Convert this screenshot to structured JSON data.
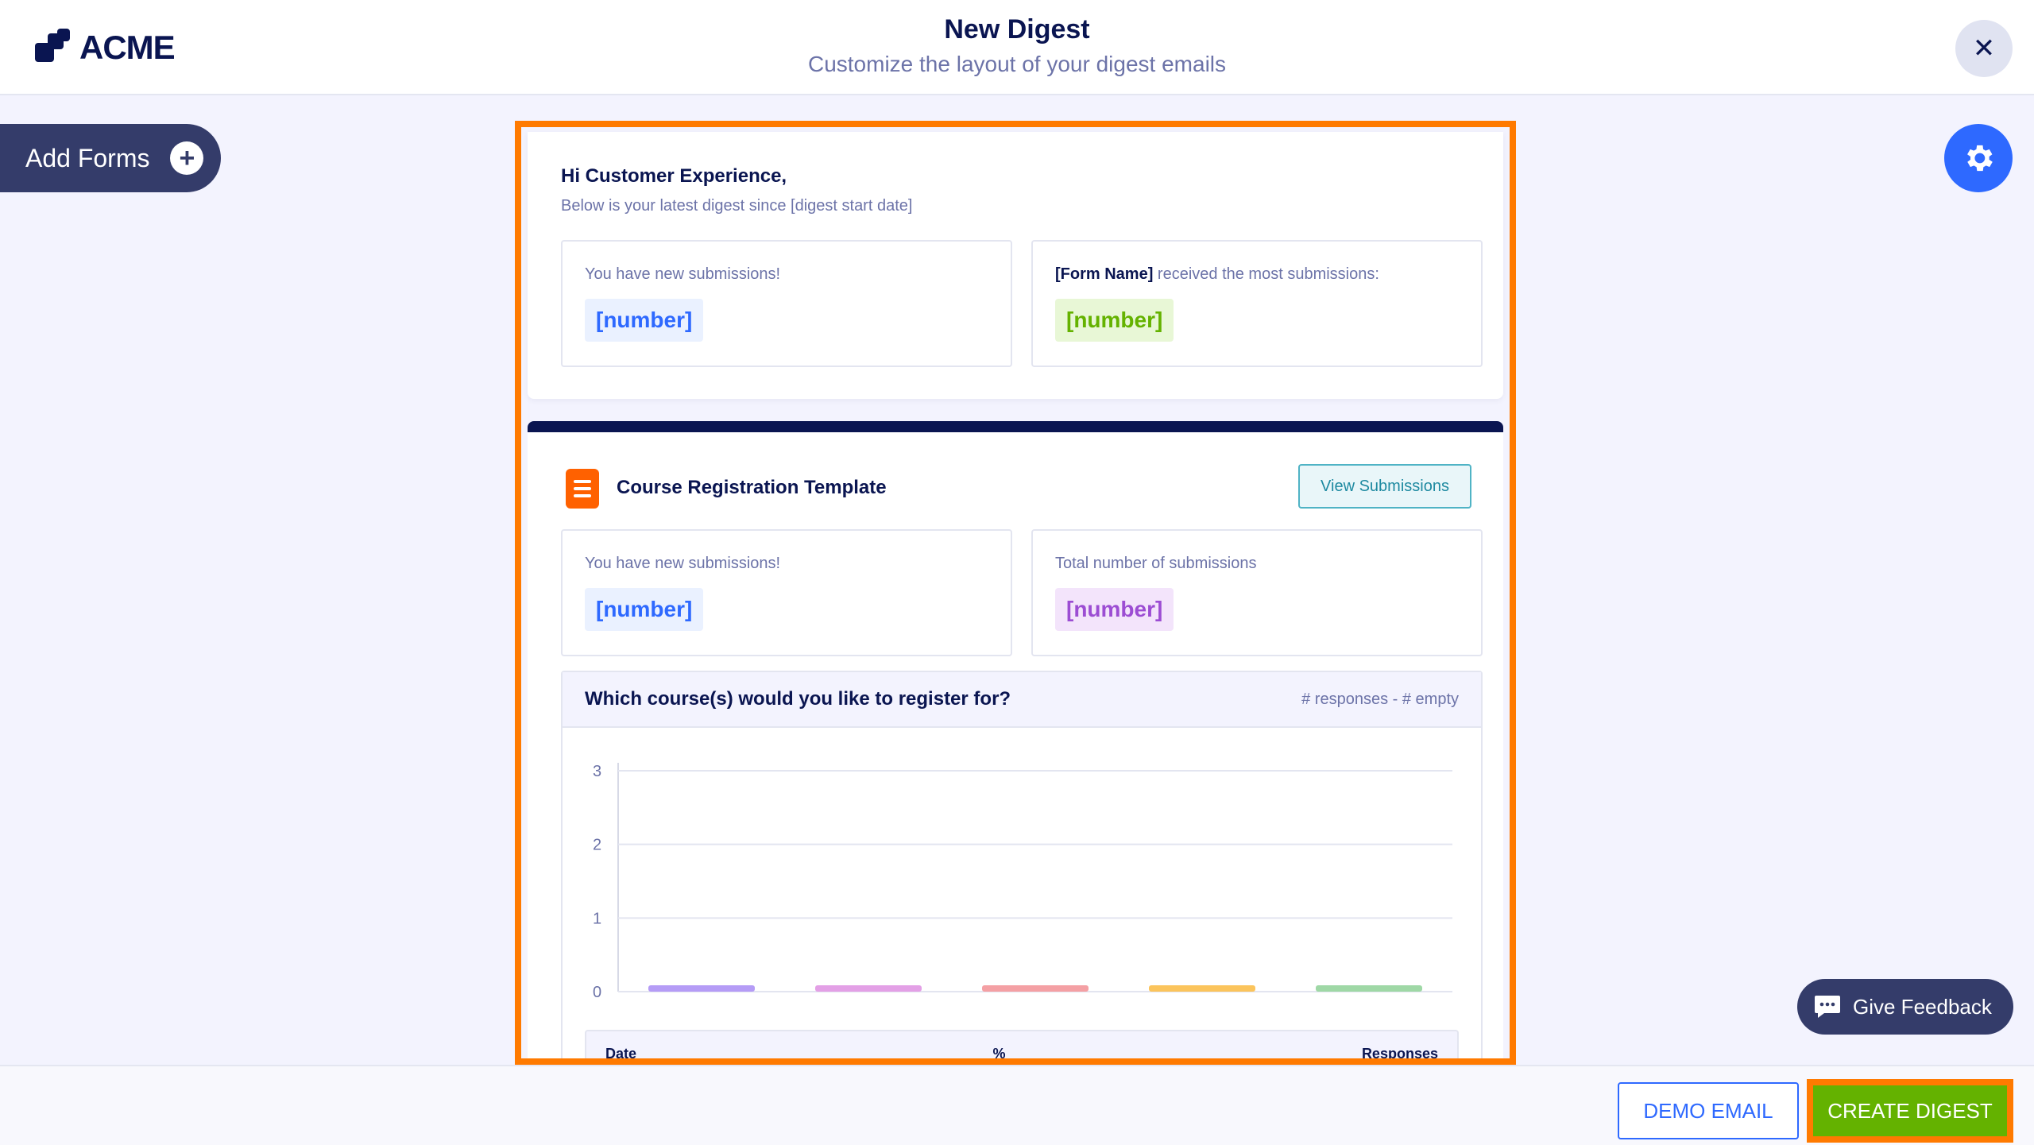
{
  "header": {
    "logo_text": "ACME",
    "title": "New Digest",
    "subtitle": "Customize the layout of your digest emails",
    "close_symbol": "✕"
  },
  "sidebar": {
    "add_forms_label": "Add Forms",
    "add_icon": "plus-circle-icon"
  },
  "settings": {
    "icon": "gear-icon",
    "color": "#2e69ff"
  },
  "digest": {
    "greeting": "Hi Customer Experience,",
    "greeting_sub": "Below is your latest digest since [digest start date]",
    "summary": {
      "new_submissions_label": "You have new submissions!",
      "new_submissions_value": "[number]",
      "form_name": "[Form Name]",
      "most_submissions_label": " received the most submissions:",
      "most_submissions_value": "[number]"
    },
    "form": {
      "title": "Course Registration Template",
      "view_button": "View Submissions",
      "new_submissions_label": "You have new submissions!",
      "new_submissions_value": "[number]",
      "total_label": "Total number of submissions",
      "total_value": "[number]",
      "question": {
        "title": "Which course(s) would you like to register for?",
        "meta": "# responses - # empty",
        "table_headers": [
          "Date",
          "%",
          "Responses"
        ]
      }
    }
  },
  "chart_data": {
    "type": "bar",
    "categories": [
      "",
      "",
      "",
      "",
      ""
    ],
    "values": [
      0,
      0,
      0,
      0,
      0
    ],
    "colors": [
      "#b59cf6",
      "#e3a0e6",
      "#f4a0a4",
      "#fbc45c",
      "#9fd8a6"
    ],
    "yticks": [
      0,
      1,
      2,
      3
    ],
    "ylim": [
      0,
      3
    ],
    "grid": true
  },
  "feedback": {
    "label": "Give Feedback",
    "icon": "feedback-chat-icon"
  },
  "footer": {
    "demo_label": "DEMO EMAIL",
    "create_label": "CREATE DIGEST"
  },
  "colors": {
    "accent": "#ff7a00",
    "primary": "#2e69ff",
    "success": "#64b200",
    "navy": "#0a1551"
  }
}
